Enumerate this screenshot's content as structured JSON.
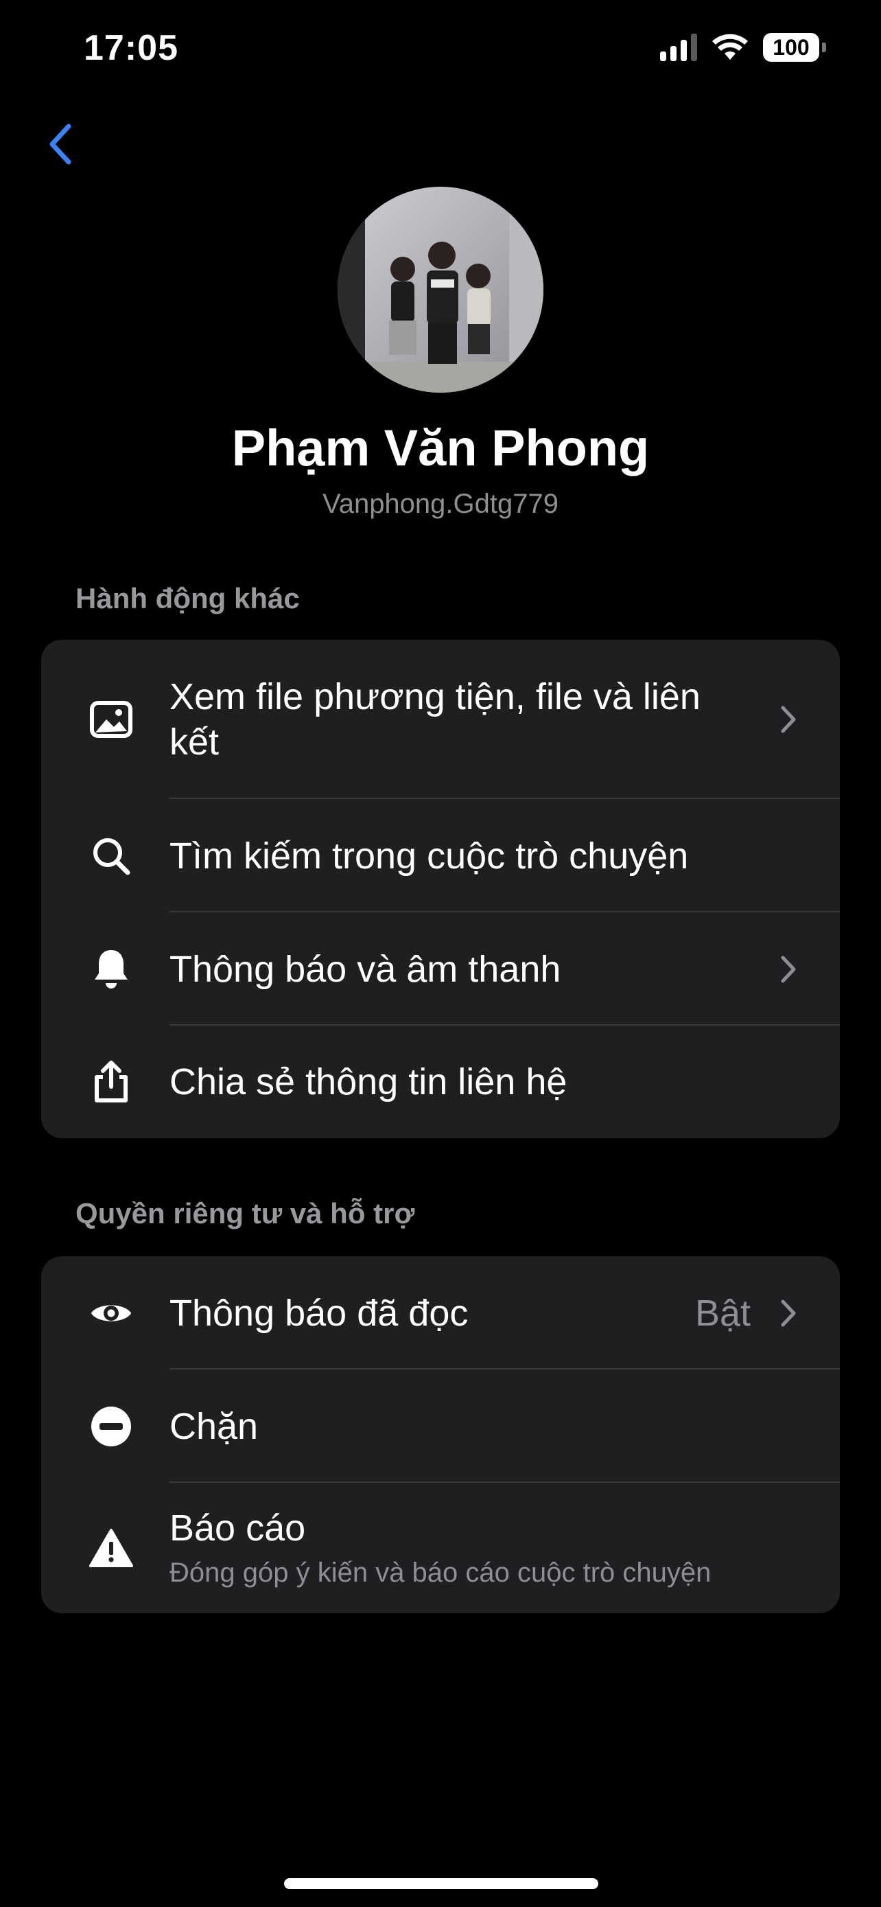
{
  "status_bar": {
    "time": "17:05",
    "battery": "100",
    "icons": [
      "signal-icon",
      "wifi-icon",
      "battery-icon"
    ]
  },
  "navigation": {
    "back_icon": "chevron-left-icon",
    "accent_color": "#3b82f6"
  },
  "profile": {
    "name": "Phạm Văn Phong",
    "username": "Vanphong.Gdtg779"
  },
  "sections": [
    {
      "title": "Hành động khác",
      "items": [
        {
          "label": "Xem file phương tiện, file và liên kết",
          "icon": "image-icon",
          "has_chevron": true
        },
        {
          "label": "Tìm kiếm trong cuộc trò chuyện",
          "icon": "search-icon",
          "has_chevron": false
        },
        {
          "label": "Thông báo và âm thanh",
          "icon": "bell-icon",
          "has_chevron": true
        },
        {
          "label": "Chia sẻ thông tin liên hệ",
          "icon": "share-icon",
          "has_chevron": false
        }
      ]
    },
    {
      "title": "Quyền riêng tư và hỗ trợ",
      "items": [
        {
          "label": "Thông báo đã đọc",
          "icon": "eye-icon",
          "value": "Bật",
          "has_chevron": true
        },
        {
          "label": "Chặn",
          "icon": "block-icon",
          "has_chevron": false
        },
        {
          "label": "Báo cáo",
          "sublabel": "Đóng góp ý kiến và báo cáo cuộc trò chuyện",
          "icon": "warning-icon",
          "has_chevron": false
        }
      ]
    }
  ],
  "colors": {
    "background": "#000000",
    "card": "#1f1f21",
    "secondary_text": "#8e8e93",
    "section_title": "#98989d"
  }
}
